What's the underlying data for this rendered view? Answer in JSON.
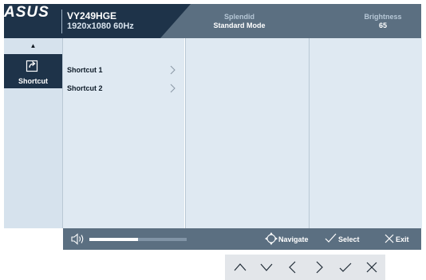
{
  "header": {
    "brand_logo": "ASUS",
    "model": "VY249HGE",
    "resolution": "1920x1080 60Hz",
    "splendid_label": "Splendid",
    "splendid_value": "Standard Mode",
    "brightness_label": "Brightness",
    "brightness_value": "65"
  },
  "sidebar": {
    "scroll_up_icon": "triangle-up-icon",
    "items": [
      {
        "label": "Shortcut",
        "icon": "shortcut-arrow-icon",
        "selected": true
      }
    ]
  },
  "submenu": {
    "items": [
      {
        "label": "Shortcut 1"
      },
      {
        "label": "Shortcut 2"
      }
    ]
  },
  "footer": {
    "volume_icon": "speaker-icon",
    "volume_level_fraction": 0.5,
    "navigate_label": "Navigate",
    "select_label": "Select",
    "exit_label": "Exit"
  },
  "buttons": [
    "chevron-up-icon",
    "chevron-down-icon",
    "chevron-left-icon",
    "chevron-right-icon",
    "check-icon",
    "close-icon"
  ],
  "colors": {
    "header_bg": "#5b6f81",
    "brand_panel_bg": "#1e3349",
    "selected_tab_bg": "#1e3349",
    "panel_bg": "#dfe9f2",
    "sidebar_bg": "#d6e2ed"
  }
}
